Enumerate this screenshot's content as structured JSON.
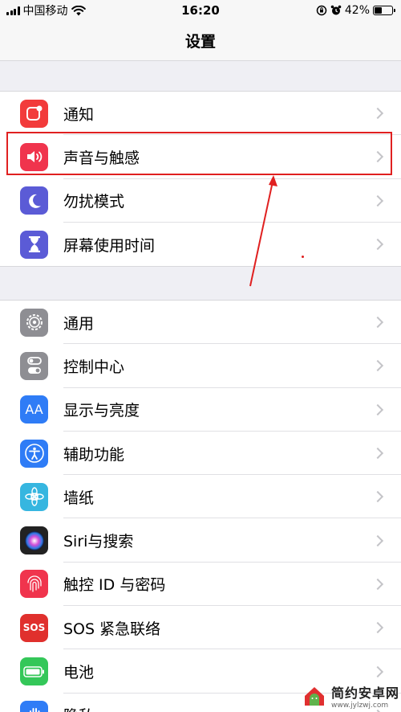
{
  "status_bar": {
    "carrier": "中国移动",
    "time": "16:20",
    "battery_percent": "42%",
    "battery_level": 0.42
  },
  "nav": {
    "title": "设置"
  },
  "groups": [
    {
      "items": [
        {
          "label": "通知",
          "icon": "notifications-icon",
          "color": "#f23b3b"
        },
        {
          "label": "声音与触感",
          "icon": "sound-icon",
          "color": "#f0344d"
        },
        {
          "label": "勿扰模式",
          "icon": "moon-icon",
          "color": "#5b5bd6"
        },
        {
          "label": "屏幕使用时间",
          "icon": "hourglass-icon",
          "color": "#5b5bd6"
        }
      ]
    },
    {
      "items": [
        {
          "label": "通用",
          "icon": "gear-icon",
          "color": "#8e8e93"
        },
        {
          "label": "控制中心",
          "icon": "toggles-icon",
          "color": "#8e8e93"
        },
        {
          "label": "显示与亮度",
          "icon": "aa-icon",
          "color": "#2f7cf6"
        },
        {
          "label": "辅助功能",
          "icon": "accessibility-icon",
          "color": "#2f7cf6"
        },
        {
          "label": "墙纸",
          "icon": "flower-icon",
          "color": "#36b6e0"
        },
        {
          "label": "Siri与搜索",
          "icon": "siri-icon",
          "color": "#222222"
        },
        {
          "label": "触控 ID 与密码",
          "icon": "fingerprint-icon",
          "color": "#f0344d"
        },
        {
          "label": "SOS 紧急联络",
          "icon": "sos-icon",
          "color": "#e0302d"
        },
        {
          "label": "电池",
          "icon": "battery-icon",
          "color": "#34c759"
        },
        {
          "label": "隐私",
          "icon": "hand-icon",
          "color": "#2f7cf6"
        }
      ]
    }
  ],
  "icon_text": {
    "aa": "AA",
    "sos": "SOS"
  },
  "watermark": {
    "name": "简约安卓网",
    "url": "www.jylzwj.com"
  },
  "colors": {
    "highlight": "#e02020",
    "background": "#efeff4"
  }
}
